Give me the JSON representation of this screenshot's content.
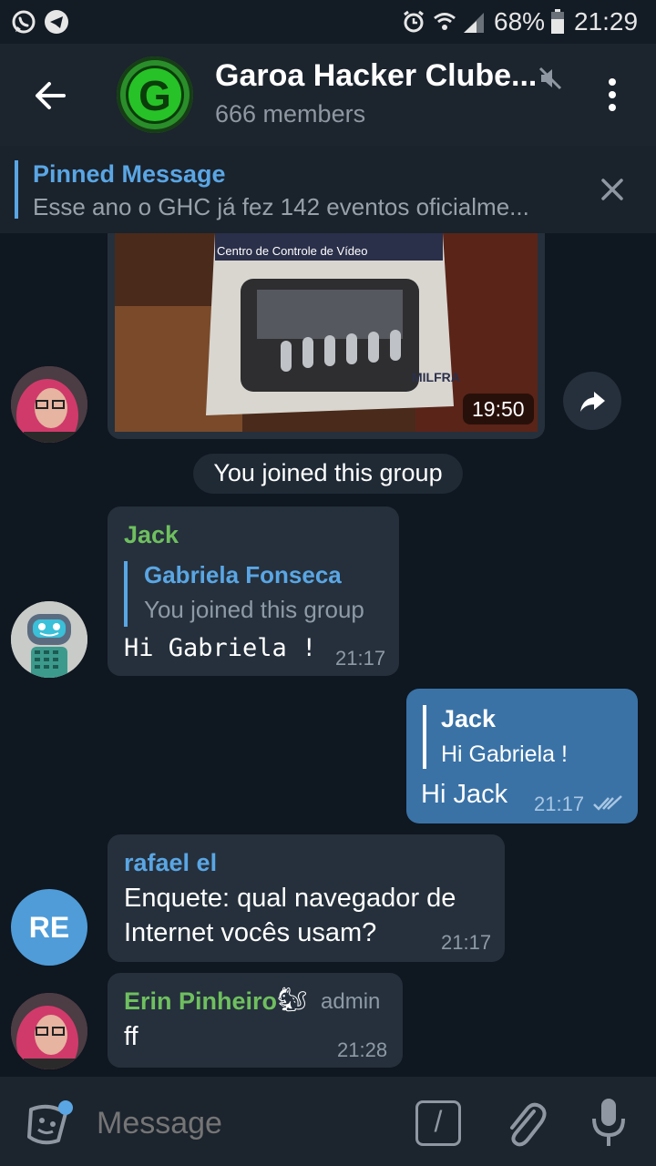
{
  "status_bar": {
    "battery": "68%",
    "time": "21:29"
  },
  "header": {
    "title": "Garoa Hacker Clube...",
    "subtitle": "666 members",
    "avatar_letter": "G"
  },
  "pinned": {
    "title": "Pinned Message",
    "text": "Esse ano o GHC já fez 142 eventos oficialme..."
  },
  "video": {
    "box_label": "Centro de Controle de Vídeo",
    "brand": "MILFRA",
    "duration": "19:50"
  },
  "service_message": "You joined this group",
  "messages": [
    {
      "sender": "Jack",
      "reply_name": "Gabriela Fonseca",
      "reply_text": "You joined this group",
      "text": "Hi Gabriela !",
      "time": "21:17"
    },
    {
      "reply_name": "Jack",
      "reply_text": "Hi Gabriela !",
      "text": "Hi Jack",
      "time": "21:17"
    },
    {
      "sender": "rafael el",
      "avatar_initials": "RE",
      "text_line1": "Enquete: qual navegador de",
      "text_line2": "Internet vocês usam?",
      "time": "21:17"
    },
    {
      "sender": "Erin Pinheiro",
      "sender_emoji": "🐿",
      "role": "admin",
      "text": "ff",
      "time": "21:28"
    }
  ],
  "composer": {
    "placeholder": "Message",
    "command_glyph": "/"
  },
  "colors": {
    "accent": "#5aa6e4",
    "outgoing_bubble": "#3a72a6",
    "incoming_bubble": "#25303c",
    "green_name": "#6fbf5f"
  }
}
